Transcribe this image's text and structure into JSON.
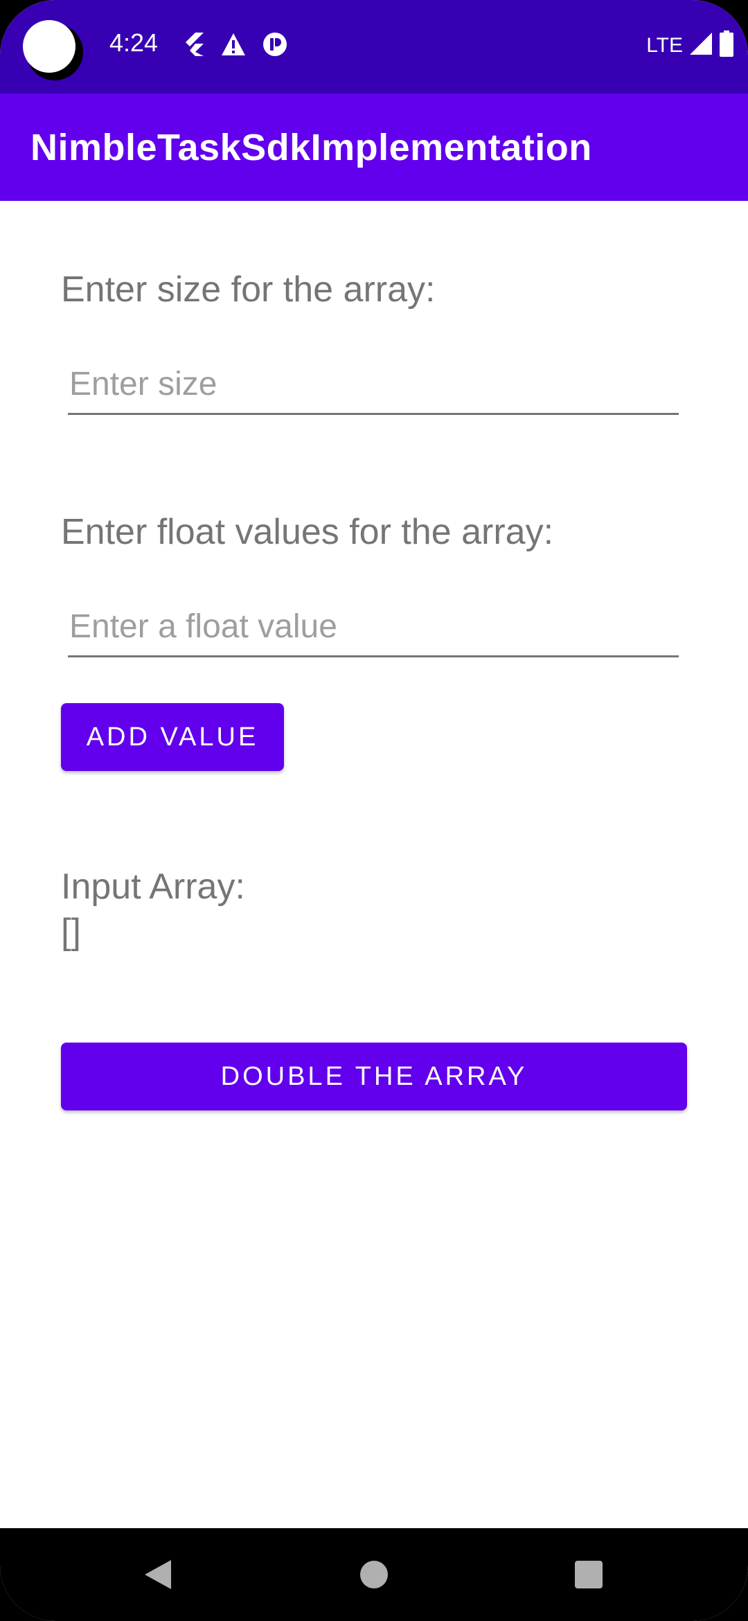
{
  "status_bar": {
    "time": "4:24",
    "network_label": "LTE",
    "icons": [
      "flutter-icon",
      "warning-icon",
      "pocket-icon",
      "signal-icon",
      "battery-icon"
    ]
  },
  "app_bar": {
    "title": "NimbleTaskSdkImplementation",
    "color": "#6200ee"
  },
  "form": {
    "size_label": "Enter size for the array:",
    "size_placeholder": "Enter size",
    "size_value": "",
    "float_label": "Enter float values for the array:",
    "float_placeholder": "Enter a float value",
    "float_value": "",
    "add_button_label": "ADD VALUE",
    "input_array_label": "Input Array:",
    "input_array_value": "[]",
    "double_button_label": "DOUBLE THE ARRAY"
  },
  "nav_bar": {
    "icons": [
      "back-icon",
      "home-icon",
      "recents-icon"
    ]
  },
  "colors": {
    "status_bar": "#3700b3",
    "primary": "#6200ee",
    "label_text": "#757575",
    "hint_text": "#9e9e9e"
  }
}
